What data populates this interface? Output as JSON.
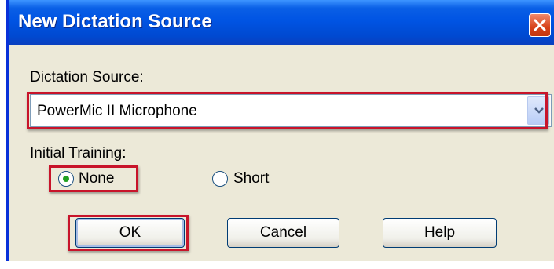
{
  "window": {
    "title": "New Dictation Source"
  },
  "dictation_source": {
    "label": "Dictation Source:",
    "value": "PowerMic II Microphone"
  },
  "initial_training": {
    "label": "Initial Training:",
    "options": [
      {
        "label": "None",
        "selected": true
      },
      {
        "label": "Short",
        "selected": false
      }
    ]
  },
  "buttons": {
    "ok": "OK",
    "cancel": "Cancel",
    "help": "Help"
  },
  "colors": {
    "title_bar": "#0054e3",
    "highlight": "#c8142a",
    "dialog_bg": "#ece9d8"
  },
  "icons": {
    "close": "close-icon",
    "dropdown": "chevron-down-icon"
  }
}
